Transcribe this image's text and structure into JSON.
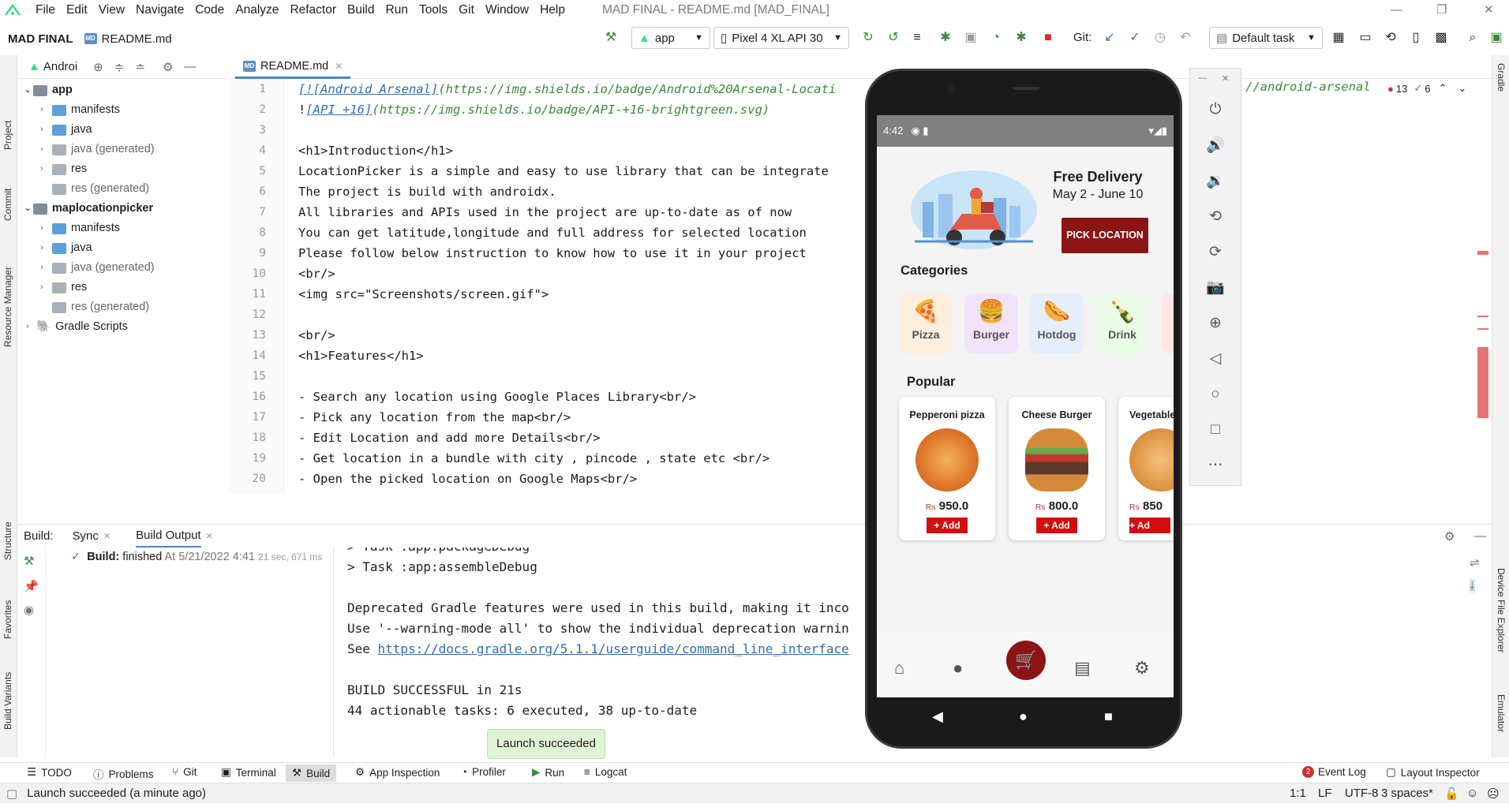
{
  "menu": {
    "items": [
      "File",
      "Edit",
      "View",
      "Navigate",
      "Code",
      "Analyze",
      "Refactor",
      "Build",
      "Run",
      "Tools",
      "Git",
      "Window",
      "Help"
    ],
    "window_title": "MAD FINAL - README.md [MAD_FINAL]"
  },
  "nav": {
    "project": "MAD FINAL",
    "file": "README.md"
  },
  "toolbar": {
    "run_config": "app",
    "device": "Pixel 4 XL API 30",
    "git_label": "Git:",
    "task": "Default task"
  },
  "sidebar_left": {
    "project": "Project",
    "commit": "Commit",
    "resource_manager": "Resource Manager",
    "structure": "Structure",
    "favorites": "Favorites",
    "build_variants": "Build Variants"
  },
  "sidebar_right": {
    "gradle": "Gradle",
    "device_file_explorer": "Device File Explorer",
    "emulator": "Emulator"
  },
  "project_panel": {
    "header": "Androi"
  },
  "tree": [
    {
      "label": "app",
      "bold": true
    },
    {
      "label": "manifests"
    },
    {
      "label": "java"
    },
    {
      "label": "java (generated)"
    },
    {
      "label": "res"
    },
    {
      "label": "res (generated)"
    },
    {
      "label": "maplocationpicker",
      "bold": true
    },
    {
      "label": "manifests"
    },
    {
      "label": "java"
    },
    {
      "label": "java (generated)"
    },
    {
      "label": "res"
    },
    {
      "label": "res (generated)"
    },
    {
      "label": "Gradle Scripts"
    }
  ],
  "editor": {
    "tab": "README.md",
    "line_numbers": [
      "1",
      "2",
      "3",
      "4",
      "5",
      "6",
      "7",
      "8",
      "9",
      "10",
      "11",
      "12",
      "13",
      "14",
      "15",
      "16",
      "17",
      "18",
      "19",
      "20"
    ],
    "line1_link": "[![Android Arsenal]",
    "line1_url": "(https://img.shields.io/badge/Android%20Arsenal-Locati",
    "line1_tail": "//android-arsenal",
    "line2_prefix": "!",
    "line2_link": "[API +16]",
    "line2_url": "(https://img.shields.io/badge/API-+16-brightgreen.svg)",
    "lines": [
      "",
      "<h1>Introduction</h1>",
      "LocationPicker is a simple and easy to use library that can be integrate",
      "The project is build with androidx.",
      "All libraries and APIs used in the project are up-to-date as of now",
      "You can get latitude,longitude and full address for selected location",
      "Please follow below instruction to know how to use it in your project",
      "<br/>",
      "<img src=\"Screenshots/screen.gif\">",
      "",
      "<br/>",
      "<h1>Features</h1>",
      "",
      "- Search any location using Google Places Library<br/>",
      "- Pick any location from the map<br/>",
      "- Edit Location and add more Details<br/>",
      "- Get location in a bundle with city , pincode , state etc <br/>",
      "- Open the picked location on Google Maps<br/>"
    ],
    "errors": "13",
    "warnings": "6"
  },
  "build": {
    "label": "Build:",
    "tab_sync": "Sync",
    "tab_output": "Build Output",
    "status_bold": "Build:",
    "status_text": "finished",
    "status_time": "At 5/21/2022 4:41",
    "status_duration": "21 sec, 671 ms",
    "console": [
      "> Task :app:packageDebug",
      "> Task :app:assembleDebug",
      "",
      "Deprecated Gradle features were used in this build, making it inco",
      "Use '--warning-mode all' to show the individual deprecation warnin",
      "See ",
      "",
      "BUILD SUCCESSFUL in 21s",
      "44 actionable tasks: 6 executed, 38 up-to-date"
    ],
    "console_link": "https://docs.gradle.org/5.1.1/userguide/command_line_interface"
  },
  "toast": "Launch succeeded",
  "bottom_tabs": [
    "TODO",
    "Problems",
    "Git",
    "Terminal",
    "Build",
    "App Inspection",
    "Profiler",
    "Run",
    "Logcat"
  ],
  "event_log": {
    "count": "2",
    "label": "Event Log"
  },
  "layout_inspector": "Layout Inspector",
  "status": {
    "message": "Launch succeeded (a minute ago)",
    "position": "1:1",
    "line_sep": "LF",
    "encoding": "UTF-8",
    "indent": "3 spaces*"
  },
  "phone": {
    "time": "4:42",
    "promo_title": "Free Delivery",
    "promo_dates": "May 2 - June 10",
    "pick_button": "PICK LOCATION",
    "categories_title": "Categories",
    "categories": [
      {
        "name": "Pizza",
        "icon": "pizza-icon",
        "bg": "#fdeede"
      },
      {
        "name": "Burger",
        "icon": "burger-icon",
        "bg": "#f1e4fa"
      },
      {
        "name": "Hotdog",
        "icon": "hotdog-icon",
        "bg": "#e5effc"
      },
      {
        "name": "Drink",
        "icon": "drink-icon",
        "bg": "#eafbe8"
      }
    ],
    "popular_title": "Popular",
    "items": [
      {
        "name": "Pepperoni pizza",
        "currency": "Rs",
        "price": "950.0",
        "add": "+ Add"
      },
      {
        "name": "Cheese Burger",
        "currency": "Rs",
        "price": "800.0",
        "add": "+ Add"
      },
      {
        "name": "Vegetable",
        "currency": "Rs",
        "price": "850",
        "add": "+ Ad"
      }
    ]
  },
  "colors": {
    "accent": "#8b1414",
    "add_red": "#d10f0f",
    "link": "#2a6fb6",
    "toast": "#dff3d6"
  }
}
